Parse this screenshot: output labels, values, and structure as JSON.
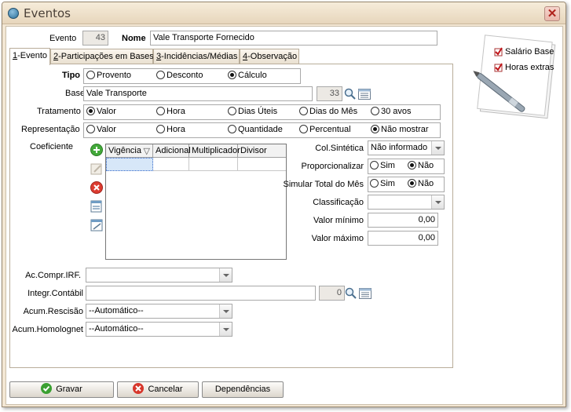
{
  "window": {
    "title": "Eventos"
  },
  "header": {
    "evento_label": "Evento",
    "evento_value": "43",
    "nome_label": "Nome",
    "nome_value": "Vale Transporte Fornecido"
  },
  "tabs": [
    {
      "key": "1",
      "label": "-Evento"
    },
    {
      "key": "2",
      "label": "-Participações em Bases"
    },
    {
      "key": "3",
      "label": "-Incidências/Médias"
    },
    {
      "key": "4",
      "label": "-Observação"
    }
  ],
  "form": {
    "tipo": {
      "label": "Tipo",
      "options": [
        "Provento",
        "Desconto",
        "Cálculo"
      ],
      "selected": "Cálculo"
    },
    "base": {
      "label": "Base",
      "value": "Vale Transporte",
      "code": "33"
    },
    "tratamento": {
      "label": "Tratamento",
      "options": [
        "Valor",
        "Hora",
        "Dias Úteis",
        "Dias do Mês",
        "30 avos"
      ],
      "selected": "Valor"
    },
    "representacao": {
      "label": "Representação",
      "options": [
        "Valor",
        "Hora",
        "Quantidade",
        "Percentual",
        "Não mostrar"
      ],
      "selected": "Não mostrar"
    },
    "coeficiente": {
      "label": "Coeficiente",
      "columns": [
        "Vigência",
        "Adicional",
        "Multiplicador",
        "Divisor"
      ],
      "sort_indicator": "▽"
    },
    "col_sintetica": {
      "label": "Col.Sintética",
      "value": "Não informado"
    },
    "proporcionalizar": {
      "label": "Proporcionalizar",
      "options": [
        "Sim",
        "Não"
      ],
      "selected": "Não"
    },
    "simular_total": {
      "label": "Simular Total do Mês",
      "options": [
        "Sim",
        "Não"
      ],
      "selected": "Não"
    },
    "classificacao": {
      "label": "Classificação",
      "value": ""
    },
    "valor_minimo": {
      "label": "Valor mínimo",
      "value": "0,00"
    },
    "valor_maximo": {
      "label": "Valor máximo",
      "value": "0,00"
    },
    "ac_compr_irf": {
      "label": "Ac.Compr.IRF.",
      "value": ""
    },
    "integr_contabil": {
      "label": "Integr.Contábil",
      "value": "",
      "code": "0"
    },
    "acum_rescisao": {
      "label": "Acum.Rescisão",
      "value": "--Automático--"
    },
    "acum_homolognet": {
      "label": "Acum.Homolognet",
      "value": "--Automático--"
    }
  },
  "buttons": {
    "save": "Gravar",
    "cancel": "Cancelar",
    "dependencies": "Dependências"
  },
  "side_note": {
    "items": [
      "Salário Base",
      "Horas extras"
    ]
  },
  "colors": {
    "frame": "#f3e7d4",
    "selection": "#d7e7f8",
    "save_icon": "#3aa031",
    "cancel_icon": "#d7372c"
  }
}
